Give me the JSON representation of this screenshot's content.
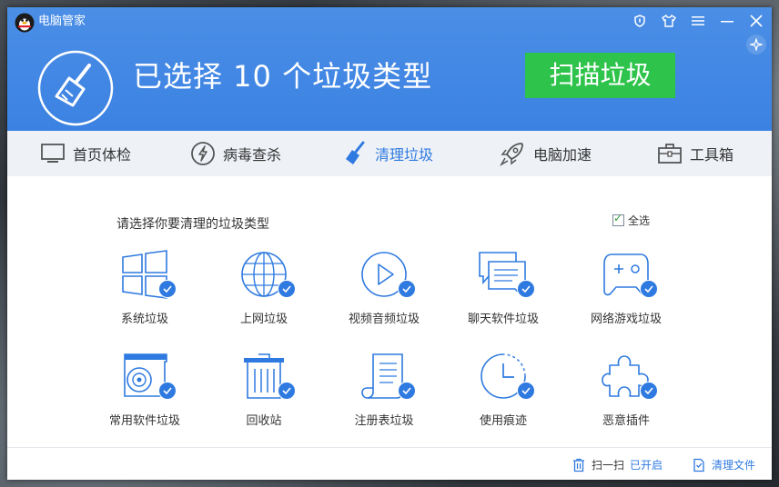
{
  "app": {
    "title": "电脑管家"
  },
  "header": {
    "headline": "已选择 10 个垃圾类型",
    "scan_button": "扫描垃圾"
  },
  "nav": [
    {
      "label": "首页体检",
      "icon": "monitor-icon"
    },
    {
      "label": "病毒查杀",
      "icon": "bolt-icon"
    },
    {
      "label": "清理垃圾",
      "icon": "broom-icon",
      "active": true
    },
    {
      "label": "电脑加速",
      "icon": "rocket-icon"
    },
    {
      "label": "工具箱",
      "icon": "toolbox-icon"
    }
  ],
  "content": {
    "section_title": "请选择你要清理的垃圾类型",
    "select_all": "全选",
    "categories": [
      {
        "label": "系统垃圾",
        "icon": "windows-icon",
        "checked": true
      },
      {
        "label": "上网垃圾",
        "icon": "globe-icon",
        "checked": true
      },
      {
        "label": "视频音频垃圾",
        "icon": "play-icon",
        "checked": true
      },
      {
        "label": "聊天软件垃圾",
        "icon": "chat-icon",
        "checked": true
      },
      {
        "label": "网络游戏垃圾",
        "icon": "gamepad-icon",
        "checked": true
      },
      {
        "label": "常用软件垃圾",
        "icon": "disc-drive-icon",
        "checked": true
      },
      {
        "label": "回收站",
        "icon": "trash-icon",
        "checked": true
      },
      {
        "label": "注册表垃圾",
        "icon": "scroll-icon",
        "checked": true
      },
      {
        "label": "使用痕迹",
        "icon": "clock-icon",
        "checked": true
      },
      {
        "label": "恶意插件",
        "icon": "puzzle-icon",
        "checked": true
      }
    ]
  },
  "footer": {
    "scan_prefix": "扫一扫",
    "scan_status": "已开启",
    "clean_files": "清理文件"
  },
  "colors": {
    "accent": "#3c82e2",
    "scan_button": "#2ec34a",
    "badge": "#2f7ae0"
  }
}
